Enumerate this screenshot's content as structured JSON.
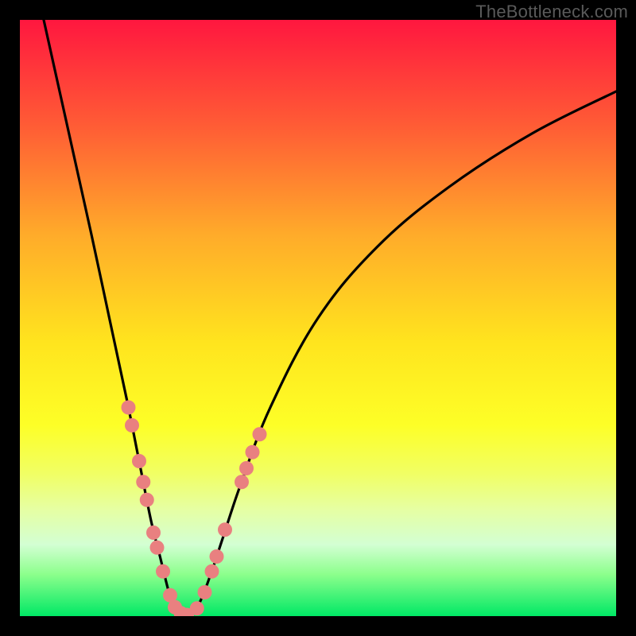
{
  "watermark": "TheBottleneck.com",
  "chart_data": {
    "type": "line",
    "title": "",
    "xlabel": "",
    "ylabel": "",
    "xlim": [
      0,
      100
    ],
    "ylim": [
      0,
      100
    ],
    "background": "red-to-green vertical gradient",
    "series": [
      {
        "name": "left-curve",
        "x": [
          4,
          8,
          12,
          15,
          18,
          20,
          22,
          23.5,
          25,
          26,
          27,
          28
        ],
        "y": [
          100,
          82,
          64,
          50,
          36,
          26,
          16,
          10,
          4,
          1.5,
          0.5,
          0
        ]
      },
      {
        "name": "right-curve",
        "x": [
          28,
          30,
          32,
          34,
          37,
          42,
          50,
          60,
          72,
          86,
          100
        ],
        "y": [
          0,
          2,
          7,
          13,
          22,
          35,
          50,
          62,
          72,
          81,
          88
        ]
      }
    ],
    "markers": [
      {
        "series": "left-curve",
        "x": 18.2,
        "y": 35
      },
      {
        "series": "left-curve",
        "x": 18.8,
        "y": 32
      },
      {
        "series": "left-curve",
        "x": 20.0,
        "y": 26
      },
      {
        "series": "left-curve",
        "x": 20.7,
        "y": 22.5
      },
      {
        "series": "left-curve",
        "x": 21.3,
        "y": 19.5
      },
      {
        "series": "left-curve",
        "x": 22.4,
        "y": 14
      },
      {
        "series": "left-curve",
        "x": 23.0,
        "y": 11.5
      },
      {
        "series": "left-curve",
        "x": 24.0,
        "y": 7.5
      },
      {
        "series": "left-curve",
        "x": 25.2,
        "y": 3.5
      },
      {
        "series": "left-curve",
        "x": 26.0,
        "y": 1.5
      },
      {
        "series": "left-curve",
        "x": 27.0,
        "y": 0.5
      },
      {
        "series": "left-curve",
        "x": 28.0,
        "y": 0.2
      },
      {
        "series": "right-curve",
        "x": 29.7,
        "y": 1.3
      },
      {
        "series": "right-curve",
        "x": 31.0,
        "y": 4
      },
      {
        "series": "right-curve",
        "x": 32.2,
        "y": 7.5
      },
      {
        "series": "right-curve",
        "x": 33.0,
        "y": 10
      },
      {
        "series": "right-curve",
        "x": 34.4,
        "y": 14.5
      },
      {
        "series": "right-curve",
        "x": 37.2,
        "y": 22.5
      },
      {
        "series": "right-curve",
        "x": 38.0,
        "y": 24.8
      },
      {
        "series": "right-curve",
        "x": 39.0,
        "y": 27.5
      },
      {
        "series": "right-curve",
        "x": 40.2,
        "y": 30.5
      }
    ],
    "marker_style": {
      "color": "#e98080",
      "radius_px": 9
    }
  }
}
